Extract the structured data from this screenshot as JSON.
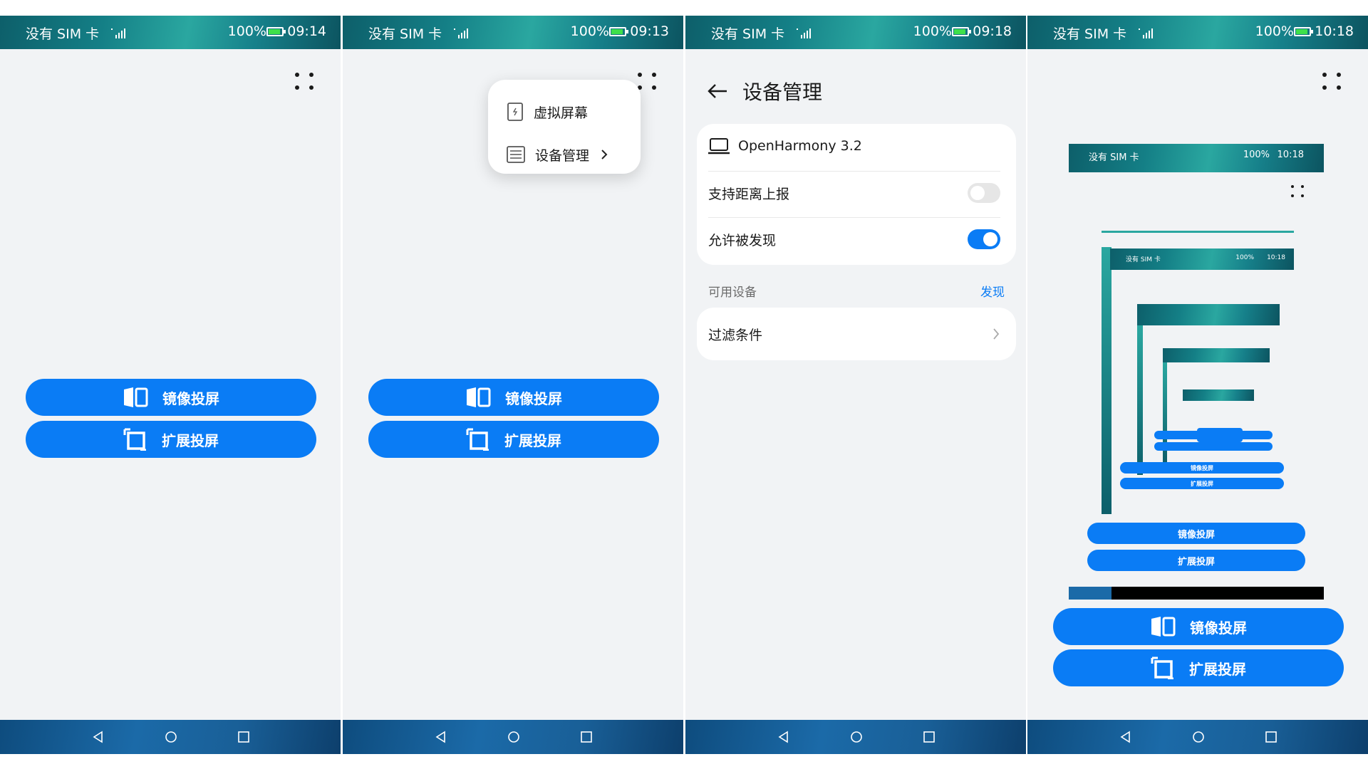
{
  "status_bar": {
    "sim_text": "没有 SIM 卡",
    "battery_text": "100%",
    "times": [
      "09:14",
      "09:13",
      "09:18",
      "10:18"
    ]
  },
  "buttons": {
    "mirror": "镜像投屏",
    "extend": "扩展投屏"
  },
  "popup_menu": {
    "items": [
      {
        "label": "虚拟屏幕",
        "icon": "virtual-screen-icon"
      },
      {
        "label": "设备管理",
        "icon": "device-list-icon"
      }
    ]
  },
  "device_mgmt": {
    "title": "设备管理",
    "device_name": "OpenHarmony 3.2",
    "support_distance_label": "支持距离上报",
    "support_distance_on": false,
    "allow_discover_label": "允许被发现",
    "allow_discover_on": true,
    "available_label": "可用设备",
    "discover_action": "发现",
    "filter_label": "过滤条件"
  },
  "nested": {
    "sim_text": "没有 SIM 卡",
    "battery_text": "100%",
    "time": "10:18"
  },
  "colors": {
    "accent": "#0a7cf5",
    "toggle_off": "#e6e6e6",
    "background": "#f1f3f5"
  }
}
